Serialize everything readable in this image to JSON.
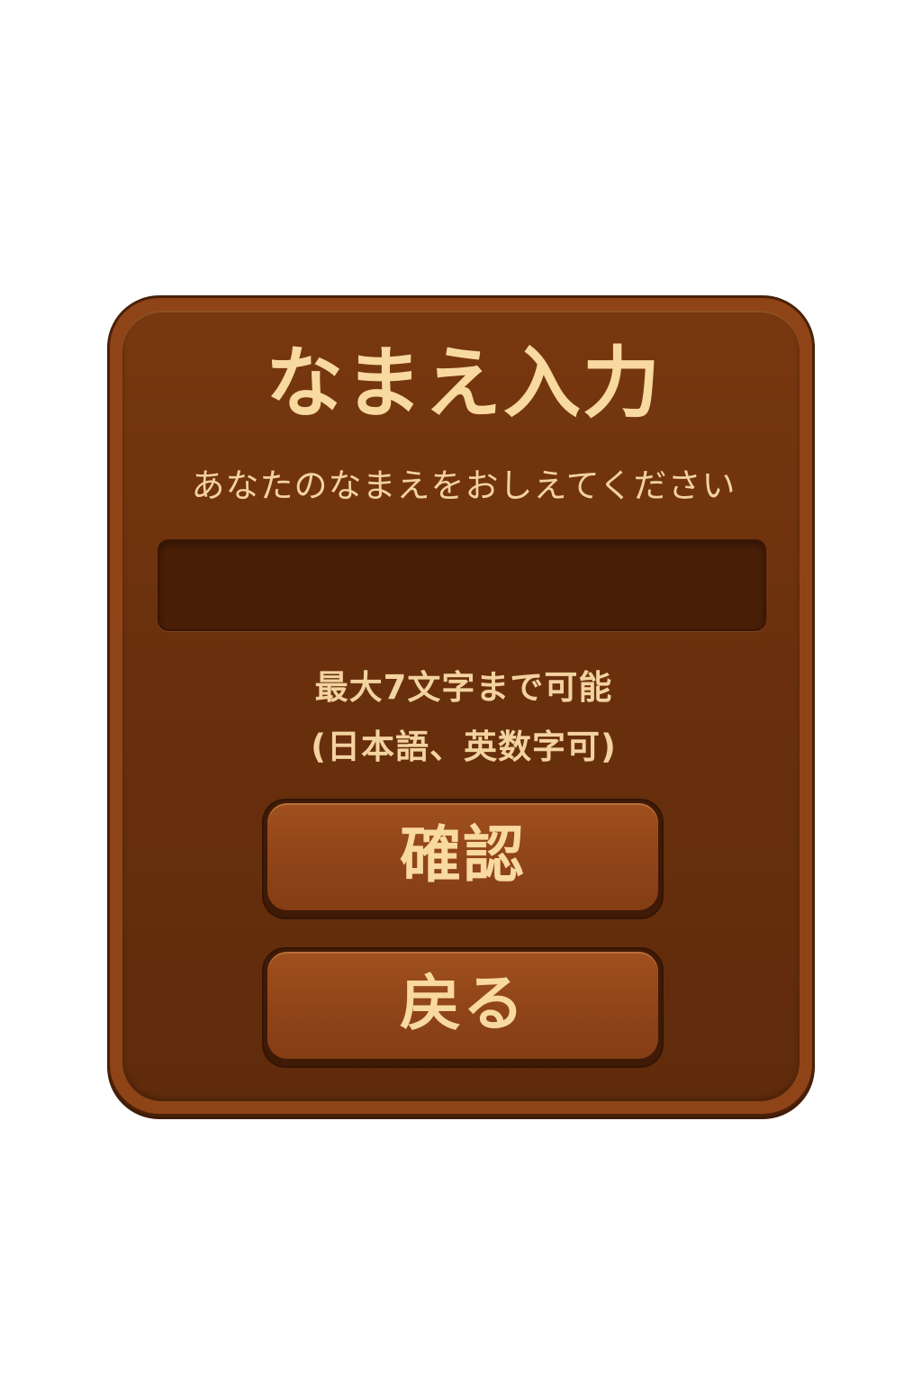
{
  "dialog": {
    "title": "なまえ入力",
    "subtitle": "あなたのなまえをおしえてください",
    "name_input": {
      "value": "",
      "placeholder": ""
    },
    "notes": [
      "最大7文字まで可能",
      "(日本語、英数字可)"
    ],
    "buttons": {
      "confirm_label": "確認",
      "back_label": "戻る"
    }
  },
  "colors": {
    "panel": "#6a300d",
    "panel_border": "#8f4418",
    "input_bg": "#4a1f07",
    "button_face": "#8f4418",
    "text": "#f8d9a0"
  }
}
